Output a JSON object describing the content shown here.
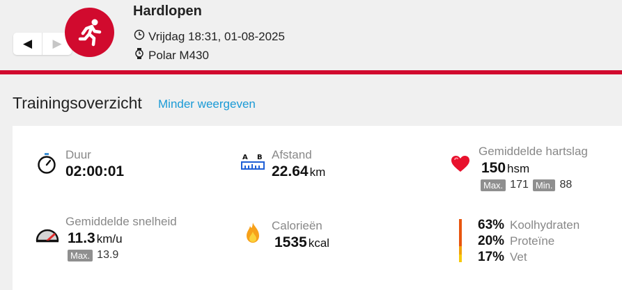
{
  "header": {
    "sport": "Hardlopen",
    "datetime": "Vrijdag 18:31, 01-08-2025",
    "device": "Polar M430",
    "prev_label": "◀",
    "next_label": "▶"
  },
  "section": {
    "title": "Trainingsoverzicht",
    "toggle": "Minder weergeven"
  },
  "stats": {
    "duration": {
      "label": "Duur",
      "value": "02:00:01"
    },
    "distance": {
      "label": "Afstand",
      "value": "22.64",
      "unit": "km",
      "icon_text": "A  B"
    },
    "heart_rate": {
      "label": "Gemiddelde hartslag",
      "value": "150",
      "unit": "hsm",
      "max_label": "Max.",
      "max": "171",
      "min_label": "Min.",
      "min": "88"
    },
    "speed": {
      "label": "Gemiddelde snelheid",
      "value": "11.3",
      "unit": "km/u",
      "max_label": "Max.",
      "max": "13.9"
    },
    "calories": {
      "label": "Calorieën",
      "value": "1535",
      "unit": "kcal"
    },
    "macros": [
      {
        "percent": "63%",
        "name": "Koolhydraten",
        "color": "#e8560f"
      },
      {
        "percent": "20%",
        "name": "Proteïne",
        "color": "#f2a10b"
      },
      {
        "percent": "17%",
        "name": "Vet",
        "color": "#f7c90a"
      }
    ]
  },
  "colors": {
    "brand": "#d10a2e",
    "link": "#1a9ad6"
  }
}
